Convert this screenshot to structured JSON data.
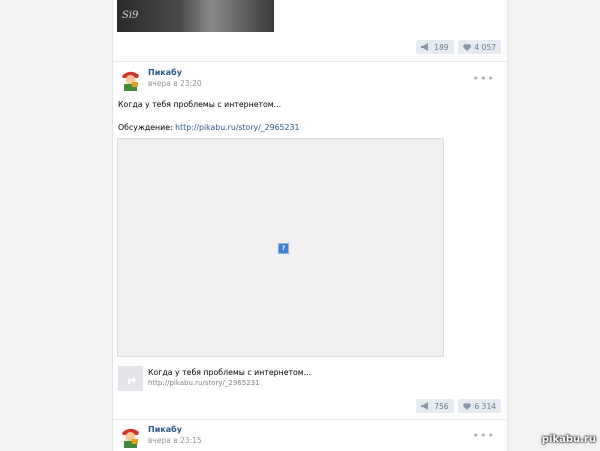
{
  "prev_post": {
    "signature": "Si9",
    "actions": {
      "share_count": "189",
      "like_count": "4 057"
    }
  },
  "post1": {
    "author": "Пикабу",
    "time": "вчера в 23:20",
    "more": "•••",
    "text_line1": "Когда у тебя проблемы с интернетом...",
    "discussion_label": "Обсуждение: ",
    "discussion_link": "http://pikabu.ru/story/_2965231",
    "broken_image_glyph": "?",
    "link_attachment": {
      "title": "Когда у тебя проблемы с интернетом...",
      "url": "http://pikabu.ru/story/_2965231"
    },
    "actions": {
      "share_count": "756",
      "like_count": "6 314"
    }
  },
  "post2": {
    "author": "Пикабу",
    "time": "вчера в 23:15",
    "more": "•••"
  },
  "watermark": "pikabu.ru",
  "colors": {
    "link": "#2a5885",
    "action_bg": "#e5ebf1",
    "action_text": "#6b7a8c"
  }
}
